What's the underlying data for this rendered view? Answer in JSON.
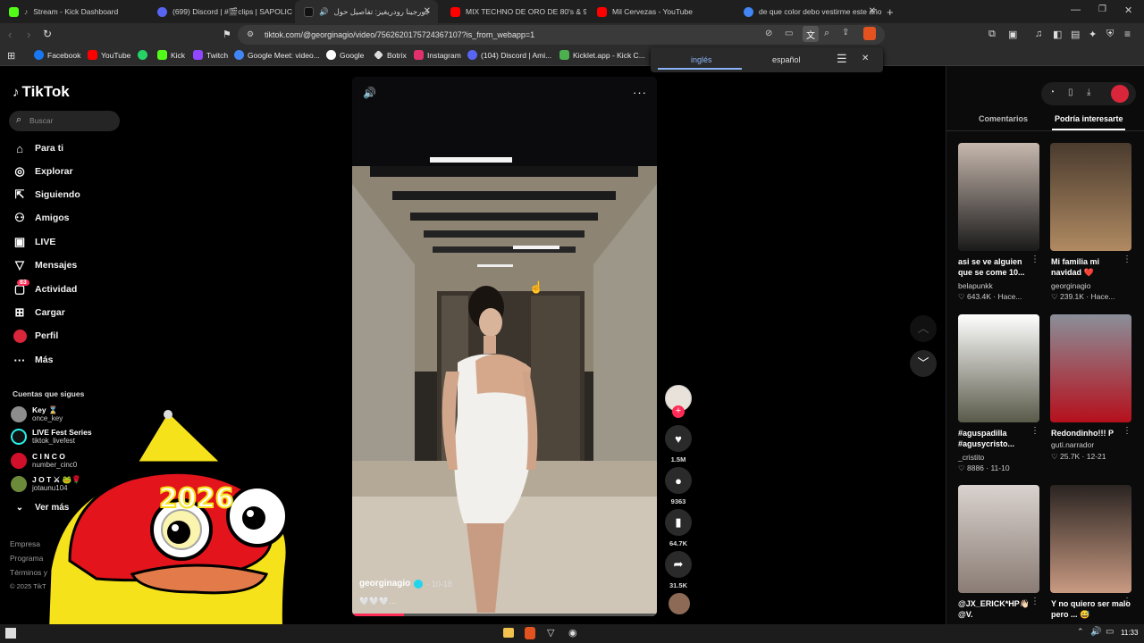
{
  "tabs": [
    {
      "label": "Stream - Kick Dashboard",
      "color": "#53fc18"
    },
    {
      "label": "(699) Discord | #🎬clips | SAPOLIC",
      "color": "#5865f2"
    },
    {
      "label": "جورجينا رودريغيز: تفاصيل حول",
      "color": "#000000"
    },
    {
      "label": "MIX TECHNO DE ORO DE 80's & 90's",
      "color": "#ff0000"
    },
    {
      "label": "Mil Cervezas - YouTube",
      "color": "#ff0000"
    },
    {
      "label": "de que color debo vestirme este año",
      "color": "#4285f4"
    }
  ],
  "url": "tiktok.com/@georginagio/video/7562620175724367107?is_from_webapp=1",
  "bookmarks": [
    "Facebook",
    "YouTube",
    "",
    "Kick",
    "Twitch",
    "Google Meet: video...",
    "Google",
    "Botrix",
    "Instagram",
    "(104) Discord | Ami...",
    "Kicklet.app - Kick C..."
  ],
  "translate": {
    "left": "inglés",
    "right": "español"
  },
  "tiktok": {
    "logo": "TikTok",
    "search_placeholder": "Buscar",
    "nav": [
      "Para ti",
      "Explorar",
      "Siguiendo",
      "Amigos",
      "LIVE",
      "Mensajes",
      "Actividad",
      "Cargar",
      "Perfil",
      "Más"
    ],
    "activity_badge": "83",
    "following_title": "Cuentas que sigues",
    "following": [
      {
        "name": "Key ⌛",
        "sub": "once_key"
      },
      {
        "name": "LIVE Fest Series",
        "sub": "tiktok_livefest"
      },
      {
        "name": "C I N C O",
        "sub": "number_cinc0"
      },
      {
        "name": "J O T ⚔ 🐸🌹",
        "sub": "jotaunu104"
      }
    ],
    "see_more": "Ver más",
    "footer": [
      "Empresa",
      "Programa",
      "Términos y",
      "© 2025 TikT"
    ],
    "sticker_text": "2026"
  },
  "video": {
    "author": "georginagio",
    "date": "10-18",
    "caption": "🤍🤍🤍...",
    "progress": 0.17
  },
  "actions": {
    "likes": "1.5M",
    "comments": "9363",
    "saves": "64.7K",
    "shares": "31.5K"
  },
  "right_tabs": [
    "Comentarios",
    "Podría interesarte"
  ],
  "cards": [
    {
      "title": "asi se ve alguien que se come 10...",
      "author": "belapunkk",
      "meta": "643.4K · Hace...",
      "colors": [
        "#c7b8ae",
        "#1a1a1a"
      ]
    },
    {
      "title": "Mi familia mi navidad ❤️",
      "author": "georginagio",
      "meta": "239.1K · Hace...",
      "colors": [
        "#4a3b2e",
        "#b08a62"
      ]
    },
    {
      "title": "#aguspadilla #agusycristo...",
      "author": "_cristito",
      "meta": "8886 · 11-10",
      "colors": [
        "#ffffff",
        "#5a5a4a"
      ]
    },
    {
      "title": "Redondinho!!! P",
      "author": "guti.narrador",
      "meta": "25.7K · 12-21",
      "colors": [
        "#8a8f99",
        "#b5101c"
      ]
    },
    {
      "title": "@JX_ERICK*HP👋🏻 @V.",
      "author": "",
      "meta": "",
      "colors": [
        "#d9d2ce",
        "#8a7c74"
      ]
    },
    {
      "title": "Y no quiero ser malo pero ... 😅",
      "author": "",
      "meta": "",
      "colors": [
        "#2a2421",
        "#c99a82"
      ]
    }
  ],
  "clock": "11:33"
}
